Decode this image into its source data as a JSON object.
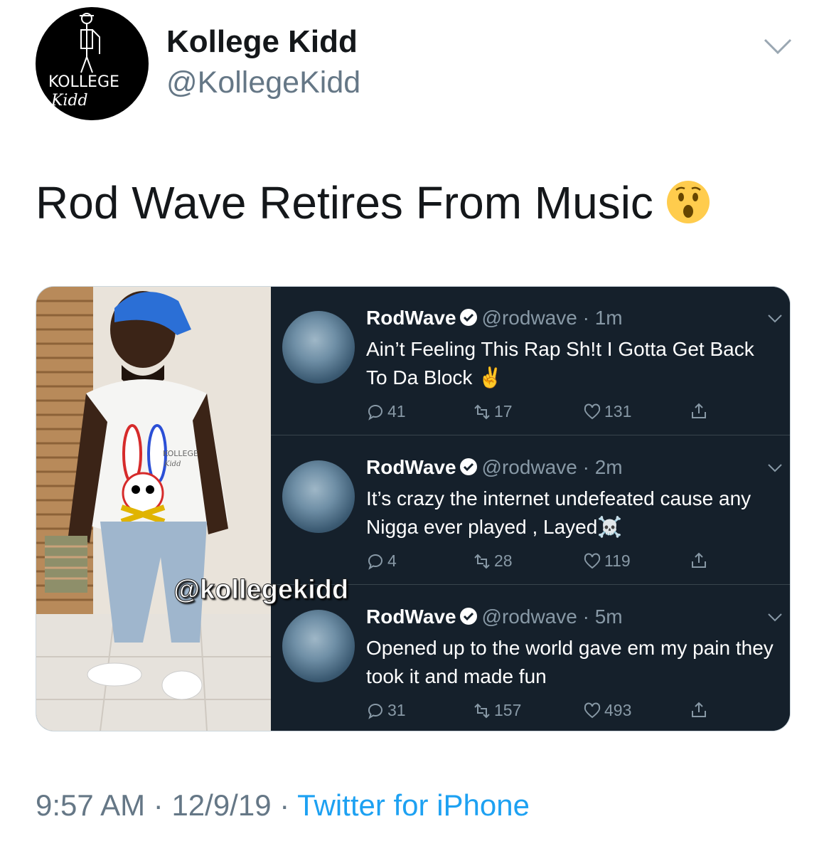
{
  "user": {
    "display_name": "Kollege Kidd",
    "handle": "@KollegeKidd",
    "avatar_text_top": "KOLLEGE",
    "avatar_text_bottom": "Kidd"
  },
  "tweet": {
    "text": "Rod Wave Retires From Music",
    "emoji": "hushed-face-emoji"
  },
  "media": {
    "watermark": "@kollegekidd",
    "shirt_text": "KOLLEGE",
    "shirt_sub": "Kidd",
    "embedded_tweets": [
      {
        "name": "RodWave",
        "handle": "@rodwave · 1m",
        "text": "Ain’t Feeling This Rap Sh!t I Gotta Get Back To Da Block ✌️",
        "replies": "41",
        "retweets": "17",
        "likes": "131"
      },
      {
        "name": "RodWave",
        "handle": "@rodwave · 2m",
        "text": "It’s crazy the internet undefeated cause any Nigga ever played , Layed☠️",
        "replies": "4",
        "retweets": "28",
        "likes": "119"
      },
      {
        "name": "RodWave",
        "handle": "@rodwave · 5m",
        "text": "Opened up to the world gave em my pain they took it and made fun",
        "replies": "31",
        "retweets": "157",
        "likes": "493"
      }
    ]
  },
  "footer": {
    "time": "9:57 AM",
    "sep1": " · ",
    "date": "12/9/19",
    "sep2": " · ",
    "source": "Twitter for iPhone"
  },
  "colors": {
    "link": "#1da1f2",
    "secondary_text": "#657786",
    "dark_bg": "#15202b"
  }
}
